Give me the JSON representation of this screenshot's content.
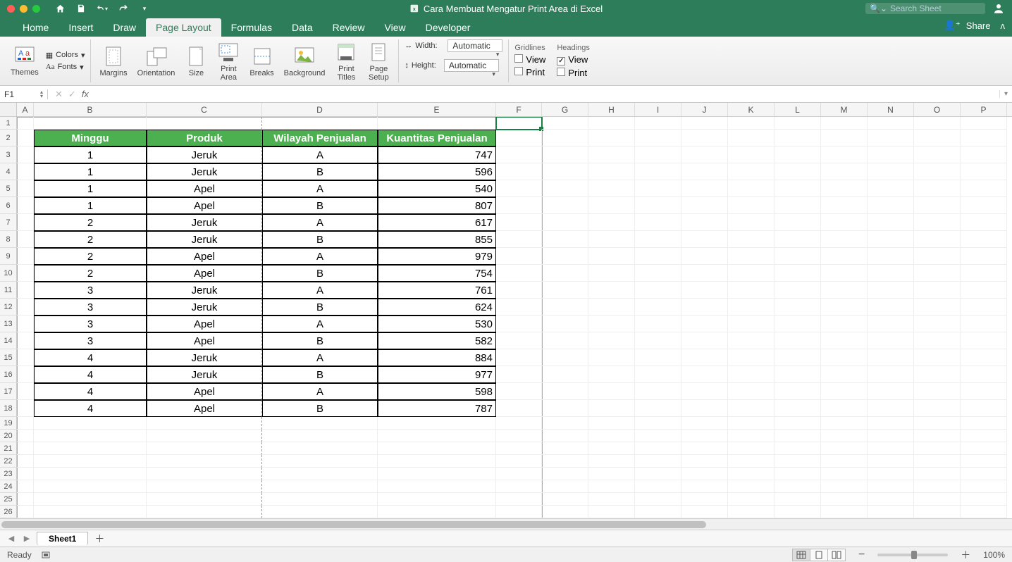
{
  "title": "Cara Membuat Mengatur Print Area di Excel",
  "search_placeholder": "Search Sheet",
  "share_label": "Share",
  "tabs": [
    "Home",
    "Insert",
    "Draw",
    "Page Layout",
    "Formulas",
    "Data",
    "Review",
    "View",
    "Developer"
  ],
  "active_tab": "Page Layout",
  "ribbon": {
    "themes": "Themes",
    "colors": "Colors",
    "fonts": "Fonts",
    "margins": "Margins",
    "orientation": "Orientation",
    "size": "Size",
    "print_area": "Print\nArea",
    "breaks": "Breaks",
    "background": "Background",
    "print_titles": "Print\nTitles",
    "page_setup": "Page\nSetup",
    "width": "Width:",
    "height": "Height:",
    "automatic": "Automatic",
    "gridlines": "Gridlines",
    "headings": "Headings",
    "view": "View",
    "print": "Print"
  },
  "namebox": "F1",
  "columns": [
    "A",
    "B",
    "C",
    "D",
    "E",
    "F",
    "G",
    "H",
    "I",
    "J",
    "K",
    "L",
    "M",
    "N",
    "O",
    "P"
  ],
  "col_widths": {
    "A": 24,
    "B": 160,
    "C": 164,
    "D": 164,
    "E": 168,
    "F": 65,
    "G": 66,
    "H": 66,
    "I": 66,
    "J": 66,
    "K": 66,
    "L": 66,
    "M": 66,
    "N": 66,
    "O": 66,
    "P": 66
  },
  "headers": [
    "Minggu",
    "Produk",
    "Wilayah Penjualan",
    "Kuantitas Penjualan"
  ],
  "rows": [
    [
      1,
      "Jeruk",
      "A",
      747
    ],
    [
      1,
      "Jeruk",
      "B",
      596
    ],
    [
      1,
      "Apel",
      "A",
      540
    ],
    [
      1,
      "Apel",
      "B",
      807
    ],
    [
      2,
      "Jeruk",
      "A",
      617
    ],
    [
      2,
      "Jeruk",
      "B",
      855
    ],
    [
      2,
      "Apel",
      "A",
      979
    ],
    [
      2,
      "Apel",
      "B",
      754
    ],
    [
      3,
      "Jeruk",
      "A",
      761
    ],
    [
      3,
      "Jeruk",
      "B",
      624
    ],
    [
      3,
      "Apel",
      "A",
      530
    ],
    [
      3,
      "Apel",
      "B",
      582
    ],
    [
      4,
      "Jeruk",
      "A",
      884
    ],
    [
      4,
      "Jeruk",
      "B",
      977
    ],
    [
      4,
      "Apel",
      "A",
      598
    ],
    [
      4,
      "Apel",
      "B",
      787
    ]
  ],
  "sheet_name": "Sheet1",
  "status": "Ready",
  "zoom": "100%"
}
